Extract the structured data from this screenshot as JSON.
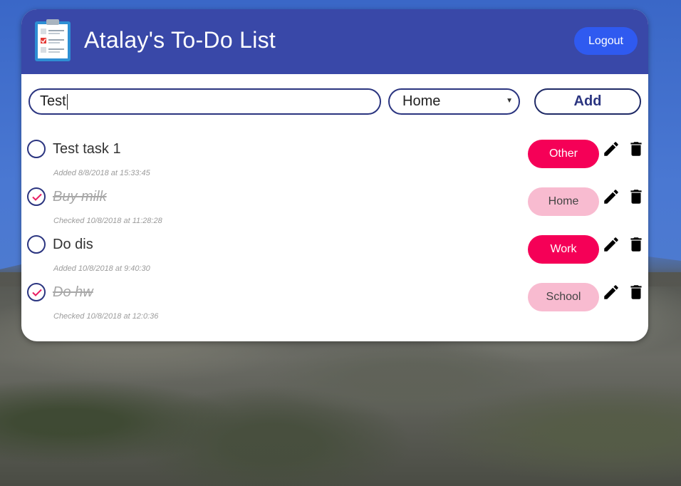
{
  "app": {
    "title": "Atalay's To-Do List",
    "logout_label": "Logout"
  },
  "form": {
    "task_value": "Test",
    "category_selected": "Home",
    "add_label": "Add"
  },
  "tasks": [
    {
      "label": "Test task 1",
      "meta": "Added 8/8/2018 at 15:33:45",
      "done": false,
      "category": "Other"
    },
    {
      "label": "Buy milk",
      "meta": "Checked 10/8/2018 at 11:28:28",
      "done": true,
      "category": "Home"
    },
    {
      "label": "Do dis",
      "meta": "Added 10/8/2018 at 9:40:30",
      "done": false,
      "category": "Work"
    },
    {
      "label": "Do hw",
      "meta": "Checked 10/8/2018 at 12:0:36",
      "done": true,
      "category": "School"
    }
  ],
  "colors": {
    "header": "#3948a8",
    "logout_button": "#2f5af0",
    "tag_active": "#f50057",
    "tag_done": "#f8bbd0",
    "checkmark": "#e91e63"
  },
  "icons": {
    "logo": "clipboard-checklist-icon",
    "edit": "pencil-icon",
    "delete": "trash-icon"
  }
}
